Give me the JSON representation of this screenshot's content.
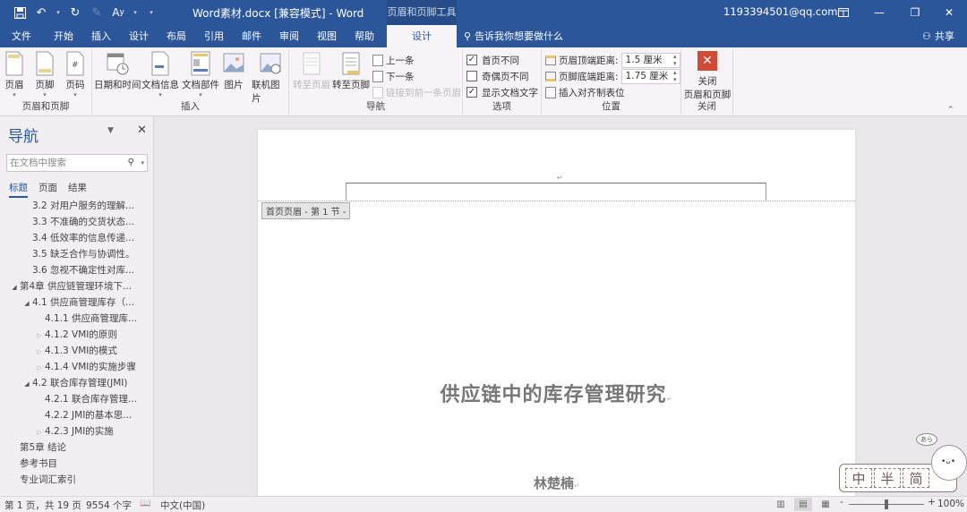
{
  "titlebar": {
    "doc_title": "Word素材.docx [兼容模式]  -  Word",
    "context_tab_group": "页眉和页脚工具",
    "user_email": "1193394501@qq.com",
    "qat_icons": [
      "save-icon",
      "undo-icon",
      "redo-icon",
      "format-painter-icon",
      "spelling-icon",
      "customize-qat-icon"
    ]
  },
  "tabs": [
    {
      "label": "文件"
    },
    {
      "label": "开始"
    },
    {
      "label": "插入"
    },
    {
      "label": "设计"
    },
    {
      "label": "布局"
    },
    {
      "label": "引用"
    },
    {
      "label": "邮件"
    },
    {
      "label": "审阅"
    },
    {
      "label": "视图"
    },
    {
      "label": "帮助"
    },
    {
      "label": "设计",
      "active": true
    }
  ],
  "tell_me": "告诉我你想要做什么",
  "share": "共享",
  "ribbon": {
    "groups": {
      "header_footer": {
        "label": "页眉和页脚",
        "buttons": [
          "页眉",
          "页脚",
          "页码"
        ]
      },
      "insert": {
        "label": "插入",
        "buttons": [
          "日期和时间",
          "文档信息",
          "文档部件",
          "图片",
          "联机图片"
        ]
      },
      "navigation": {
        "label": "导航",
        "goto_header": "转至页眉",
        "goto_footer": "转至页脚",
        "previous": "上一条",
        "next": "下一条",
        "link_to_previous": "链接到前一条页眉"
      },
      "options": {
        "label": "选项",
        "checkboxes": [
          {
            "label": "首页不同",
            "checked": true
          },
          {
            "label": "奇偶页不同",
            "checked": false
          },
          {
            "label": "显示文档文字",
            "checked": true
          }
        ]
      },
      "position": {
        "label": "位置",
        "header_from_top_label": "页眉顶端距离:",
        "header_from_top_value": "1.5 厘米",
        "footer_from_bottom_label": "页脚底端距离:",
        "footer_from_bottom_value": "1.75 厘米",
        "insert_alignment_tab": "插入对齐制表位"
      },
      "close": {
        "label": "关闭",
        "button_line1": "关闭",
        "button_line2": "页眉和页脚"
      }
    }
  },
  "nav": {
    "title": "导航",
    "search_placeholder": "在文档中搜索",
    "tabs": [
      {
        "label": "标题",
        "active": true
      },
      {
        "label": "页面"
      },
      {
        "label": "结果"
      }
    ],
    "items": [
      {
        "label": "3.2 对用户服务的理解...",
        "level": 2,
        "toggle": ""
      },
      {
        "label": "3.3 不准确的交货状态...",
        "level": 2,
        "toggle": ""
      },
      {
        "label": "3.4 低效率的信息传递...",
        "level": 2,
        "toggle": ""
      },
      {
        "label": "3.5 缺乏合作与协调性。",
        "level": 2,
        "toggle": ""
      },
      {
        "label": "3.6 忽视不确定性对库...",
        "level": 2,
        "toggle": ""
      },
      {
        "label": "第4章 供应链管理环境下...",
        "level": 1,
        "toggle": "expanded"
      },
      {
        "label": "4.1 供应商管理库存（...",
        "level": 2,
        "toggle": "expanded"
      },
      {
        "label": "4.1.1 供应商管理库...",
        "level": 3,
        "toggle": ""
      },
      {
        "label": "4.1.2 VMI的原则",
        "level": 3,
        "toggle": "collapsed"
      },
      {
        "label": "4.1.3 VMI的模式",
        "level": 3,
        "toggle": "collapsed"
      },
      {
        "label": "4.1.4 VMI的实施步骤",
        "level": 3,
        "toggle": "collapsed"
      },
      {
        "label": "4.2 联合库存管理(JMI)",
        "level": 2,
        "toggle": "expanded"
      },
      {
        "label": "4.2.1 联合库存管理...",
        "level": 3,
        "toggle": ""
      },
      {
        "label": "4.2.2 JMI的基本思...",
        "level": 3,
        "toggle": ""
      },
      {
        "label": "4.2.3 JMI的实施",
        "level": 3,
        "toggle": "collapsed"
      },
      {
        "label": "第5章 结论",
        "level": 1,
        "toggle": ""
      },
      {
        "label": "参考书目",
        "level": 1,
        "toggle": ""
      },
      {
        "label": "专业词汇索引",
        "level": 1,
        "toggle": ""
      }
    ]
  },
  "document": {
    "header_tag": "首页页眉 - 第 1 节 -",
    "title": "供应链中的库存管理研究",
    "author": "林楚楠",
    "paragraph_mark": "↵"
  },
  "sticker": {
    "cells": [
      "中",
      "半",
      "简"
    ],
    "bubble": "あら"
  },
  "status": {
    "page": "第 1 页，共 19 页",
    "words": "9554 个字",
    "language": "中文(中国)",
    "zoom": "100%",
    "zoom_minus": "-",
    "zoom_plus": "+",
    "zoom_fraction": 0.5
  }
}
